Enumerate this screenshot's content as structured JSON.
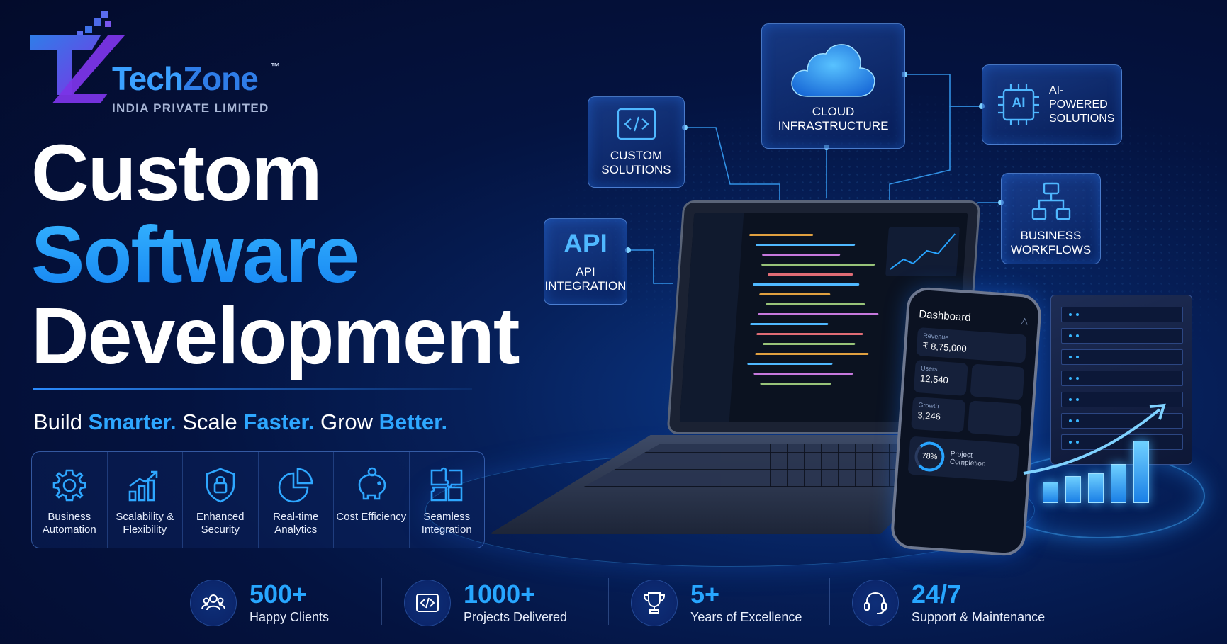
{
  "brand": {
    "name_part1": "Tech",
    "name_part2": "Zone",
    "trademark": "™",
    "subtitle": "INDIA PRIVATE LIMITED"
  },
  "headline": {
    "line1": "Custom",
    "line2": "Software",
    "line3": "Development"
  },
  "tagline": {
    "w1": "Build ",
    "a1": "Smarter.",
    "w2": " Scale ",
    "a2": "Faster.",
    "w3": " Grow ",
    "a3": "Better."
  },
  "features": [
    {
      "icon": "gear-icon",
      "label": "Business Automation"
    },
    {
      "icon": "bar-chart-growth-icon",
      "label": "Scalability & Flexibility"
    },
    {
      "icon": "shield-lock-icon",
      "label": "Enhanced Security"
    },
    {
      "icon": "pie-chart-icon",
      "label": "Real-time Analytics"
    },
    {
      "icon": "piggy-bank-icon",
      "label": "Cost Efficiency"
    },
    {
      "icon": "puzzle-icon",
      "label": "Seamless Integration"
    }
  ],
  "stats": [
    {
      "icon": "users-icon",
      "value": "500+",
      "label": "Happy Clients"
    },
    {
      "icon": "code-icon",
      "value": "1000+",
      "label": "Projects Delivered"
    },
    {
      "icon": "trophy-icon",
      "value": "5+",
      "label": "Years of Excellence"
    },
    {
      "icon": "headset-icon",
      "value": "24/7",
      "label": "Support & Maintenance"
    }
  ],
  "nodes": {
    "custom": {
      "icon": "code-brackets-icon",
      "line1": "CUSTOM",
      "line2": "SOLUTIONS"
    },
    "cloud": {
      "icon": "cloud-icon",
      "line1": "CLOUD",
      "line2": "INFRASTRUCTURE"
    },
    "ai": {
      "icon": "ai-chip-icon",
      "chip_text": "AI",
      "line1": "AI-POWERED",
      "line2": "SOLUTIONS"
    },
    "api": {
      "big": "API",
      "line1": "API",
      "line2": "INTEGRATION"
    },
    "workflows": {
      "icon": "workflow-icon",
      "line1": "BUSINESS",
      "line2": "WORKFLOWS"
    }
  },
  "phone": {
    "title": "Dashboard",
    "revenue_label": "Revenue",
    "revenue_value": "₹ 8,75,000",
    "users_label": "Users",
    "users_value": "12,540",
    "growth_label": "Growth",
    "growth_value": "3,246",
    "progress_value": "78%",
    "progress_label": "Project Completion"
  },
  "colors": {
    "accent": "#19a3ff",
    "background": "#041340",
    "text": "#ffffff"
  }
}
